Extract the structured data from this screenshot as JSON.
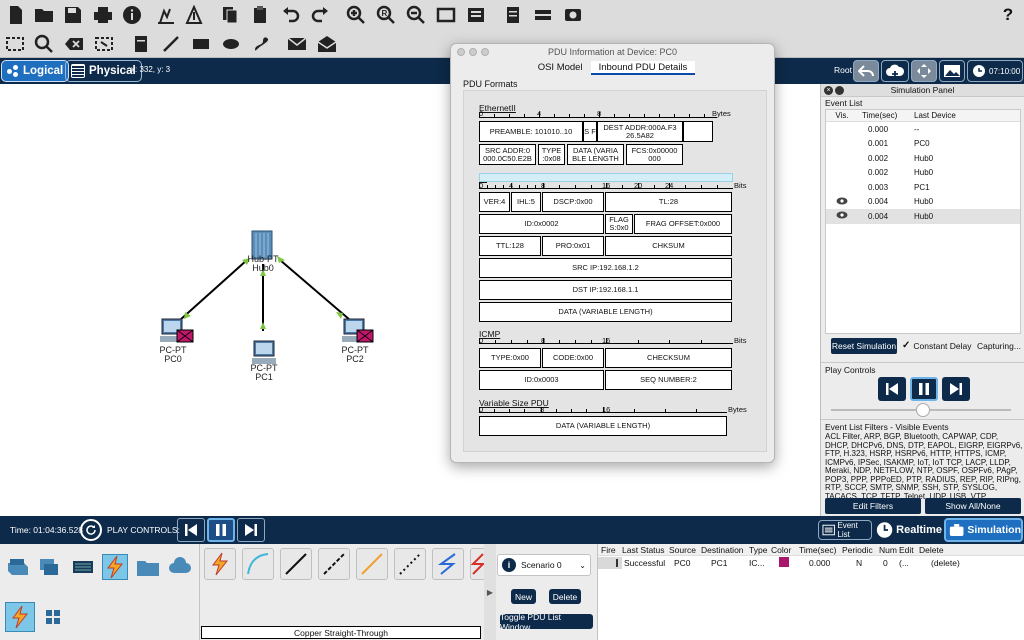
{
  "help": "?",
  "tabs": {
    "logical": "Logical",
    "physical": "Physical",
    "coords": "x: 332, y: 3"
  },
  "topright": {
    "root": "Root",
    "time": "07:10:00"
  },
  "devices": [
    {
      "name": "Hub-PT",
      "label": "Hub0"
    },
    {
      "name": "PC-PT",
      "label": "PC0"
    },
    {
      "name": "PC-PT",
      "label": "PC1"
    },
    {
      "name": "PC-PT",
      "label": "PC2"
    }
  ],
  "pdu": {
    "title": "PDU Information at Device: PC0",
    "tab_osi": "OSI Model",
    "tab_inbound": "Inbound PDU Details",
    "formats": "PDU Formats",
    "ethernet": {
      "title": "EthernetII",
      "unit": "Bytes",
      "ticks": [
        "0",
        "4",
        "8"
      ],
      "preamble": "PREAMBLE: 101010..10",
      "sfd": "S F",
      "dst": "DEST ADDR:000A.F3 26.5A82",
      "src": "SRC ADDR:0 000.0C50.E2B",
      "type": "TYPE :0x08",
      "data": "DATA (VARIA BLE LENGTH",
      "fcs": "FCS:0x00000 000"
    },
    "ip": {
      "title": "IP",
      "unit": "Bits",
      "ticks": [
        "0",
        "4",
        "8",
        "16",
        "20",
        "24"
      ],
      "ver": "VER:4",
      "ihl": "IHL:5",
      "dscp": "DSCP:0x00",
      "tl": "TL:28",
      "id": "ID:0x0002",
      "flag": "FLAG S:0x0",
      "frag": "FRAG OFFSET:0x000",
      "ttl": "TTL:128",
      "pro": "PRO:0x01",
      "chk": "CHKSUM",
      "src": "SRC IP:192.168.1.2",
      "dst": "DST IP:192.168.1.1",
      "data": "DATA (VARIABLE LENGTH)"
    },
    "icmp": {
      "title": "ICMP",
      "unit": "Bits",
      "ticks": [
        "0",
        "8",
        "16"
      ],
      "type": "TYPE:0x00",
      "code": "CODE:0x00",
      "chk": "CHECKSUM",
      "id": "ID:0x0003",
      "seq": "SEQ NUMBER:2"
    },
    "var": {
      "title": "Variable Size PDU",
      "unit": "Bytes",
      "ticks": [
        "0",
        "8",
        "16"
      ],
      "data": "DATA (VARIABLE LENGTH)"
    }
  },
  "sim": {
    "title": "Simulation Panel",
    "event_list": "Event List",
    "cols": [
      "Vis.",
      "Time(sec)",
      "Last Device"
    ],
    "events": [
      {
        "vis": "",
        "time": "0.000",
        "dev": "--"
      },
      {
        "vis": "",
        "time": "0.001",
        "dev": "PC0"
      },
      {
        "vis": "",
        "time": "0.002",
        "dev": "Hub0"
      },
      {
        "vis": "",
        "time": "0.002",
        "dev": "Hub0"
      },
      {
        "vis": "",
        "time": "0.003",
        "dev": "PC1"
      },
      {
        "vis": "eye",
        "time": "0.004",
        "dev": "Hub0"
      },
      {
        "vis": "eye",
        "time": "0.004",
        "dev": "Hub0"
      }
    ],
    "reset": "Reset Simulation",
    "constant_delay": "Constant Delay",
    "capturing": "Capturing...",
    "play_controls": "Play Controls",
    "filters_title": "Event List Filters - Visible Events",
    "filters": "ACL Filter, ARP, BGP, Bluetooth, CAPWAP, CDP, DHCP, DHCPv6, DNS, DTP, EAPOL, EIGRP, EIGRPv6, FTP, H.323, HSRP, HSRPv6, HTTP, HTTPS, ICMP, ICMPv6, IPSec, ISAKMP, IoT, IoT TCP, LACP, LLDP, Meraki, NDP, NETFLOW, NTP, OSPF, OSPFv6, PAgP, POP3, PPP, PPPoED, PTP, RADIUS, REP, RIP, RIPng, RTP, SCCP, SMTP, SNMP, SSH, STP, SYSLOG, TACACS, TCP, TFTP, Telnet, UDP, USB, VTP",
    "edit_filters": "Edit Filters",
    "show_all": "Show All/None"
  },
  "bottom": {
    "time": "Time: 01:04:36.528",
    "play_controls": "PLAY CONTROLS:",
    "event_list": "Event List",
    "realtime": "Realtime",
    "simulation": "Simulation",
    "cable_label": "Copper Straight-Through",
    "scenario": "Scenario 0",
    "new": "New",
    "delete": "Delete",
    "toggle": "Toggle PDU List Window",
    "pdu_cols": [
      "Fire",
      "Last Status",
      "Source",
      "Destination",
      "Type",
      "Color",
      "Time(sec)",
      "Periodic",
      "Num",
      "Edit",
      "Delete"
    ],
    "pdu_row": {
      "status": "Successful",
      "source": "PC0",
      "dest": "PC1",
      "type": "IC...",
      "time": "0.000",
      "periodic": "N",
      "num": "0",
      "edit": "(...",
      "delete": "(delete)"
    }
  }
}
